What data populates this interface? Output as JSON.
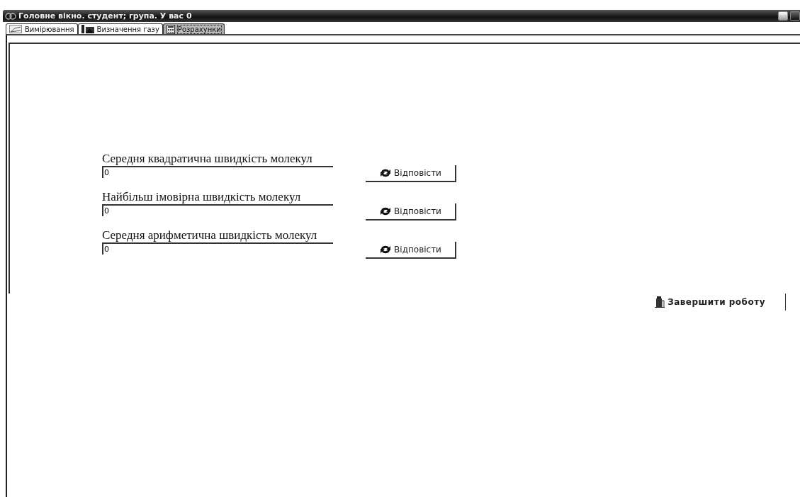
{
  "window": {
    "title": "Головне вікно. студент; група. У вас 0"
  },
  "tabs": [
    {
      "label": "Вимірювання",
      "kind": "chart",
      "selected": false
    },
    {
      "label": "Визначення газу",
      "kind": "photo",
      "selected": false
    },
    {
      "label": "Розрахунки",
      "kind": "calc",
      "selected": true
    }
  ],
  "questions": [
    {
      "label": "Середня квадратична швидкість молекул",
      "value": "0",
      "button": "Відповісти"
    },
    {
      "label": "Найбільш імовірна швидкість молекул",
      "value": "0",
      "button": "Відповісти"
    },
    {
      "label": "Середня арифметична швидкість молекул",
      "value": "0",
      "button": "Відповісти"
    }
  ],
  "finish_button": "Завершити роботу"
}
